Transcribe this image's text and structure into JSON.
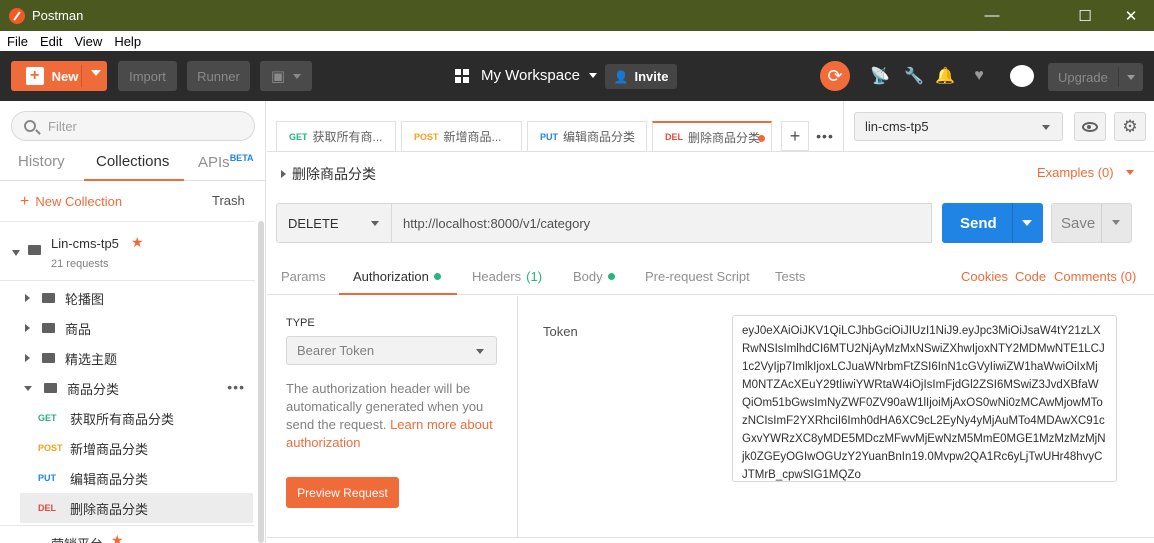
{
  "window": {
    "title": "Postman",
    "minimize": "—",
    "maximize": "☐",
    "close": "✕"
  },
  "menu": [
    "File",
    "Edit",
    "View",
    "Help"
  ],
  "toolbar": {
    "new_label": "New",
    "import_label": "Import",
    "runner_label": "Runner",
    "workspace_label": "My Workspace",
    "invite_label": "Invite",
    "upgrade_label": "Upgrade",
    "accent": "#ef6b39"
  },
  "sidebar": {
    "filter_placeholder": "Filter",
    "tabs": {
      "history": "History",
      "collections": "Collections",
      "apis": "APIs",
      "apis_badge": "BETA"
    },
    "new_collection": "New Collection",
    "trash": "Trash",
    "collection": {
      "name": "Lin-cms-tp5",
      "count": "21 requests"
    },
    "folders": [
      "轮播图",
      "商品",
      "精选主题",
      "商品分类"
    ],
    "requests": [
      {
        "method": "GET",
        "name": "获取所有商品分类",
        "color": "#26b47f"
      },
      {
        "method": "POST",
        "name": "新增商品分类",
        "color": "#f4a01c"
      },
      {
        "method": "PUT",
        "name": "编辑商品分类",
        "color": "#1f84e3"
      },
      {
        "method": "DEL",
        "name": "删除商品分类",
        "color": "#e8473a"
      }
    ],
    "next_collection": "营销平台"
  },
  "tabs": [
    {
      "method": "GET",
      "label": "获取所有商...",
      "color": "#26b47f"
    },
    {
      "method": "POST",
      "label": "新增商品...",
      "color": "#f4a01c"
    },
    {
      "method": "PUT",
      "label": "编辑商品分类",
      "color": "#1f84e3"
    },
    {
      "method": "DEL",
      "label": "删除商品分类",
      "color": "#e8473a"
    }
  ],
  "environment": "lin-cms-tp5",
  "request": {
    "name": "删除商品分类",
    "examples": "Examples (0)",
    "method": "DELETE",
    "url": "http://localhost:8000/v1/category",
    "send_label": "Send",
    "save_label": "Save"
  },
  "subtabs": {
    "params": "Params",
    "authorization": "Authorization",
    "headers": "Headers",
    "headers_count": "(1)",
    "body": "Body",
    "prerequest": "Pre-request Script",
    "tests": "Tests",
    "cookies": "Cookies",
    "code": "Code",
    "comments": "Comments (0)"
  },
  "auth": {
    "type_label": "TYPE",
    "type_value": "Bearer Token",
    "description": "The authorization header will be automatically generated when you send the request. ",
    "learn_more": "Learn more about authorization",
    "preview_label": "Preview Request",
    "token_label": "Token",
    "token": "eyJ0eXAiOiJKV1QiLCJhbGciOiJIUzI1NiJ9.eyJpc3MiOiJsaW4tY21zLXRwNSIsImlhdCI6MTU2NjAyMzMxNSwiZXhwIjoxNTY2MDMwNTE1LCJ1c2VyIjp7ImlkIjoxLCJuaWNrbmFtZSI6InN1cGVyIiwiZW1haWwiOiIxMjM0NTZAcXEuY29tIiwiYWRtaW4iOjIsImFjdGl2ZSI6MSwiZ3JvdXBfaWQiOm51bGwsImNyZWF0ZV90aW1lIjoiMjAxOS0wNi0zMCAwMjowMTozNCIsImF2YXRhciI6Imh0dHA6XC9cL2EyNy4yMjAuMTo4MDAwXC91cGxvYWRzXC8yMDE5MDczMFwvMjEwNzM5MmE0MGE1MzMzMzMjNjk0ZGEyOGIwOGUzY2YuanBnIn19.0Mvpw2QA1Rc6yLjTwUHr48hvyCJTMrB_cpwSIG1MQZo"
  }
}
